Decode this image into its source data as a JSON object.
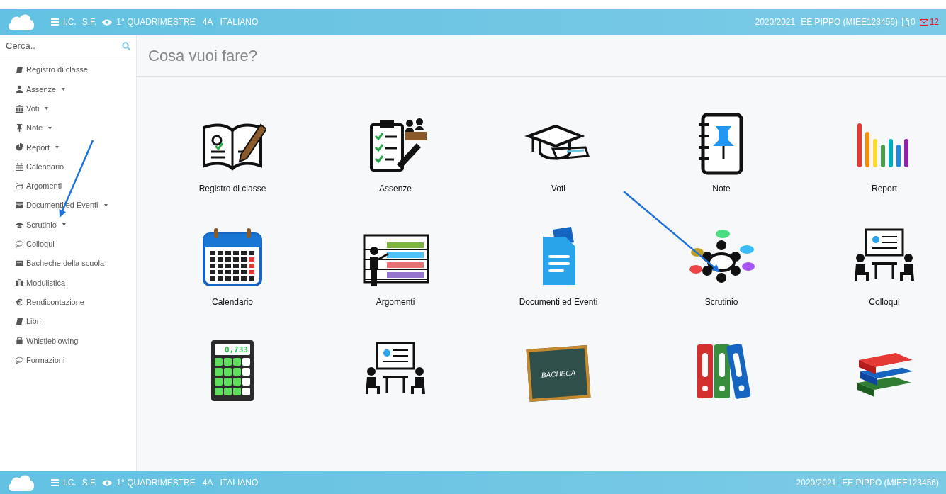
{
  "top_bar": {
    "menu": [
      "I.C.",
      "S.F."
    ],
    "period": "1° QUADRIMESTRE",
    "class": "4A",
    "subject": "ITALIANO",
    "year": "2020/2021",
    "user": "EE PIPPO (MIEE123456)",
    "documents_count": "0",
    "messages_count": "12"
  },
  "sidebar": {
    "search": {
      "placeholder": "Cerca.."
    },
    "items": [
      {
        "kind": "book",
        "label": "Registro di classe",
        "submenu": false
      },
      {
        "kind": "user",
        "label": "Assenze",
        "submenu": true
      },
      {
        "kind": "bank",
        "label": "Voti",
        "submenu": true
      },
      {
        "kind": "pin",
        "label": "Note",
        "submenu": true
      },
      {
        "kind": "pie",
        "label": "Report",
        "submenu": true
      },
      {
        "kind": "calendar",
        "label": "Calendario",
        "submenu": false
      },
      {
        "kind": "folder",
        "label": "Argomenti",
        "submenu": false
      },
      {
        "kind": "archive",
        "label": "Documenti ed Eventi",
        "submenu": true
      },
      {
        "kind": "cap",
        "label": "Scrutinio",
        "submenu": true
      },
      {
        "kind": "chat",
        "label": "Colloqui",
        "submenu": false
      },
      {
        "kind": "board",
        "label": "Bacheche della scuola",
        "submenu": false
      },
      {
        "kind": "briefcase",
        "label": "Modulistica",
        "submenu": false
      },
      {
        "kind": "euro",
        "label": "Rendicontazione",
        "submenu": false
      },
      {
        "kind": "book",
        "label": "Libri",
        "submenu": false
      },
      {
        "kind": "lock",
        "label": "Whistleblowing",
        "submenu": false
      },
      {
        "kind": "chat",
        "label": "Formazioni",
        "submenu": false
      }
    ]
  },
  "main": {
    "title": "Cosa vuoi fare?",
    "tiles": [
      {
        "kind": "register",
        "label": "Registro di classe"
      },
      {
        "kind": "absences",
        "label": "Assenze"
      },
      {
        "kind": "grades",
        "label": "Voti"
      },
      {
        "kind": "notes",
        "label": "Note"
      },
      {
        "kind": "report",
        "label": "Report"
      },
      {
        "kind": "calendar",
        "label": "Calendario"
      },
      {
        "kind": "topics",
        "label": "Argomenti"
      },
      {
        "kind": "documents",
        "label": "Documenti ed Eventi"
      },
      {
        "kind": "meeting",
        "label": "Scrutinio"
      },
      {
        "kind": "talks",
        "label": "Colloqui"
      },
      {
        "kind": "calculator",
        "display": "0,733"
      },
      {
        "kind": "talks"
      },
      {
        "kind": "chalkboard",
        "board_text": "BACHECA"
      },
      {
        "kind": "binders"
      },
      {
        "kind": "books"
      }
    ]
  },
  "bottom_bar": {
    "menu": [
      "I.C.",
      "S.F."
    ],
    "period": "1° QUADRIMESTRE",
    "class": "4A",
    "subject": "ITALIANO",
    "year": "2020/2021",
    "user": "EE PIPPO (MIEE123456)"
  }
}
